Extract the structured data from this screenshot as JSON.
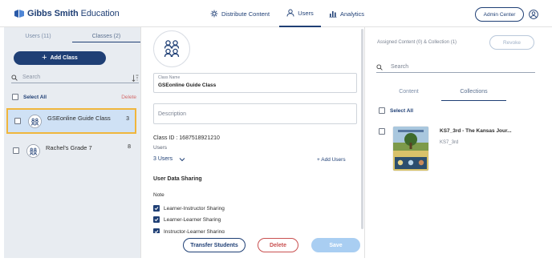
{
  "header": {
    "logo_bold": "Gibbs Smith",
    "logo_light": " Education",
    "nav": [
      {
        "label": "Distribute Content",
        "icon": "distribute-icon"
      },
      {
        "label": "Users",
        "icon": "user-icon",
        "active": true
      },
      {
        "label": "Analytics",
        "icon": "analytics-icon"
      }
    ],
    "admin_center_label": "Admin Center"
  },
  "left_panel": {
    "tabs": [
      {
        "label": "Users (11)"
      },
      {
        "label": "Classes (2)",
        "active": true
      }
    ],
    "add_class_label": "Add Class",
    "search_placeholder": "Search",
    "select_all_label": "Select All",
    "delete_label": "Delete",
    "classes": [
      {
        "name": "GSEonline Guide Class",
        "count": "3",
        "selected": true
      },
      {
        "name": "Rachel's Grade 7",
        "count": "8",
        "selected": false
      }
    ]
  },
  "class_detail": {
    "class_name_label": "Class Name",
    "class_name_value": "GSEonline Guide Class",
    "description_placeholder": "Description",
    "class_id": "Class ID : 1687518921210",
    "users_label": "Users",
    "users_count": "3 Users",
    "add_users_label": "+ Add Users",
    "user_data_sharing_title": "User Data Sharing",
    "note_label": "Note",
    "sharing_options": [
      {
        "label": "Learner-Instructor Sharing",
        "checked": true
      },
      {
        "label": "Learner-Learner Sharing",
        "checked": true
      },
      {
        "label": "Instructor-Learner Sharing",
        "checked": true
      }
    ],
    "buttons": {
      "transfer": "Transfer Students",
      "delete": "Delete",
      "save": "Save"
    }
  },
  "right_panel": {
    "assigned_label": "Assigned Content (0) & Collection (1)",
    "revoke_label": "Revoke",
    "search_placeholder": "Search",
    "tabs": [
      {
        "label": "Content"
      },
      {
        "label": "Collections",
        "active": true
      }
    ],
    "select_all_label": "Select All",
    "collections": [
      {
        "title": "KS7_3rd - The Kansas Jour...",
        "subtitle": "KS7_3rd"
      }
    ]
  },
  "colors": {
    "brand": "#1f3f75",
    "selected_row": "#cfe1f5",
    "selected_border": "#f0b63c",
    "delete_red": "#c95050",
    "save_disabled": "#a9cef2"
  }
}
